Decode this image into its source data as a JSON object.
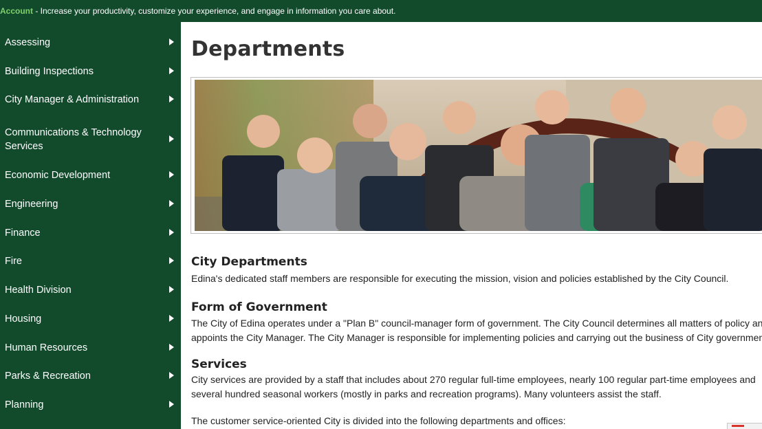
{
  "topbar": {
    "account_label": "Account",
    "message": " - Increase your productivity, customize your experience, and engage in information you care about."
  },
  "sidebar": {
    "items": [
      {
        "label": "Assessing"
      },
      {
        "label": "Building Inspections"
      },
      {
        "label": "City Manager & Administration"
      },
      {
        "label": "Communications & Technology Services"
      },
      {
        "label": "Economic Development"
      },
      {
        "label": "Engineering"
      },
      {
        "label": "Finance"
      },
      {
        "label": "Fire"
      },
      {
        "label": "Health Division"
      },
      {
        "label": "Housing"
      },
      {
        "label": "Human Resources"
      },
      {
        "label": "Parks & Recreation"
      },
      {
        "label": "Planning"
      }
    ],
    "arrow_icon": "triangle-right-icon"
  },
  "main": {
    "title": "Departments",
    "sections": [
      {
        "heading": "City Departments",
        "lines": [
          "Edina's dedicated staff members are responsible for executing the mission, vision and policies established by the City Council."
        ]
      },
      {
        "heading": "Form of Government",
        "lines": [
          "The City of Edina operates under a \"Plan B\" council-manager form of government. The City Council determines all matters of policy and",
          "appoints the City Manager. The City Manager is responsible for implementing policies and carrying out the business of City government."
        ]
      },
      {
        "heading": "Services",
        "lines": [
          "City services are provided by a staff that includes about 270 regular full-time employees, nearly 100 regular part-time employees and",
          "several hundred seasonal workers (mostly in parks and recreation programs). Many volunteers assist the staff."
        ]
      }
    ],
    "closing_line": "The customer service-oriented City is divided into the following departments and offices:"
  },
  "colors": {
    "brand_green": "#124a2c",
    "account_green": "#7fd16c"
  }
}
